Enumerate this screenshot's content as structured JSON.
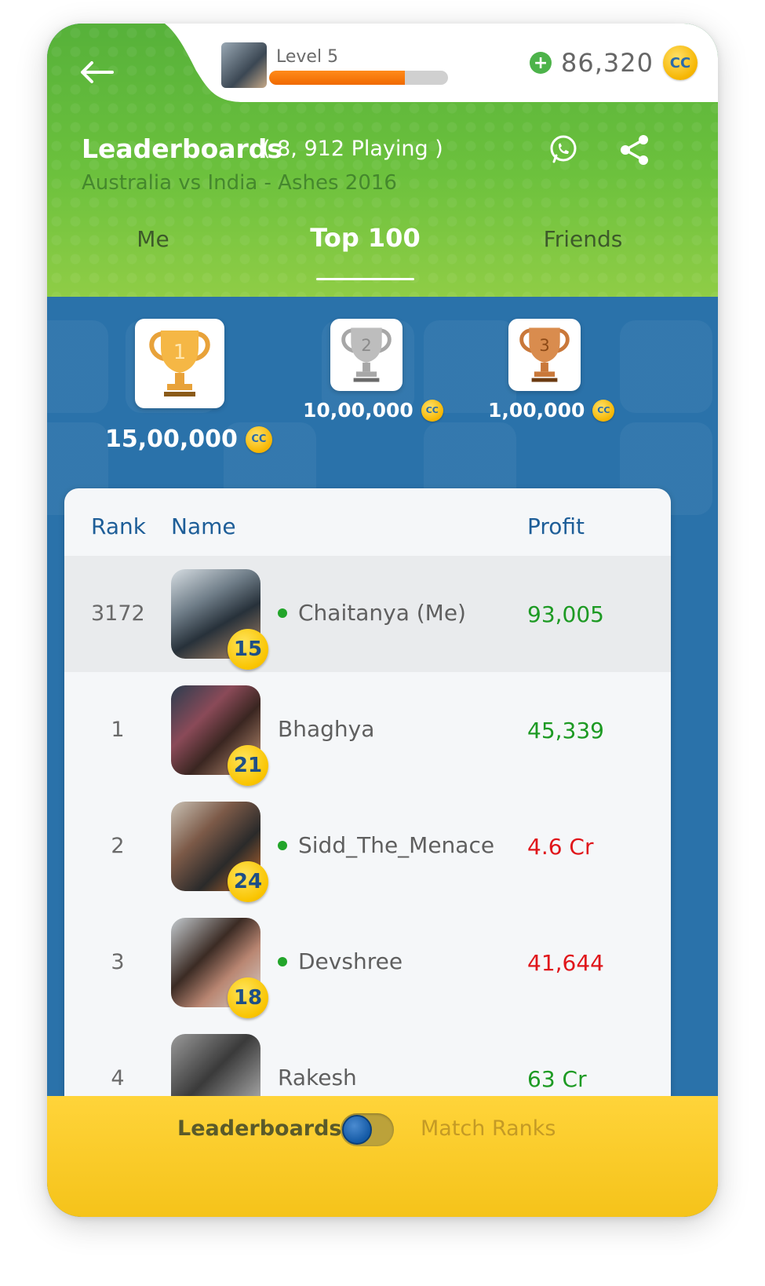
{
  "header": {
    "level_label": "Level 5",
    "level_progress": 0.76,
    "coin_balance": "86,320",
    "coin_symbol": "CC"
  },
  "leaderboard": {
    "title": "Leaderboards",
    "playing": "( 8, 912 Playing )",
    "subtitle": "Australia vs India - Ashes 2016"
  },
  "tabs": [
    {
      "label": "Me"
    },
    {
      "label": "Top 100",
      "active": true
    },
    {
      "label": "Friends"
    }
  ],
  "prizes": [
    {
      "place": "1",
      "amount": "15,00,000"
    },
    {
      "place": "2",
      "amount": "10,00,000"
    },
    {
      "place": "3",
      "amount": "1,00,000"
    }
  ],
  "table": {
    "headers": {
      "rank": "Rank",
      "name": "Name",
      "profit": "Profit"
    },
    "rows": [
      {
        "rank": "3172",
        "level": "15",
        "name": "Chaitanya (Me)",
        "online": true,
        "profit": "93,005",
        "profit_status": "positive"
      },
      {
        "rank": "1",
        "level": "21",
        "name": "Bhaghya",
        "online": false,
        "profit": "45,339",
        "profit_status": "positive"
      },
      {
        "rank": "2",
        "level": "24",
        "name": "Sidd_The_Menace",
        "online": true,
        "profit": "4.6 Cr",
        "profit_status": "negative"
      },
      {
        "rank": "3",
        "level": "18",
        "name": "Devshree",
        "online": true,
        "profit": "41,644",
        "profit_status": "negative"
      },
      {
        "rank": "4",
        "level": "",
        "name": "Rakesh",
        "online": false,
        "profit": "63 Cr",
        "profit_status": "positive"
      }
    ]
  },
  "footer": {
    "left_label": "Leaderboards",
    "right_label": "Match Ranks"
  },
  "colors": {
    "green_header": "#6cc13d",
    "blue_bg": "#1f6aa5",
    "positive": "#1d9a23",
    "negative": "#e0161b",
    "footer": "#ffd43a"
  }
}
